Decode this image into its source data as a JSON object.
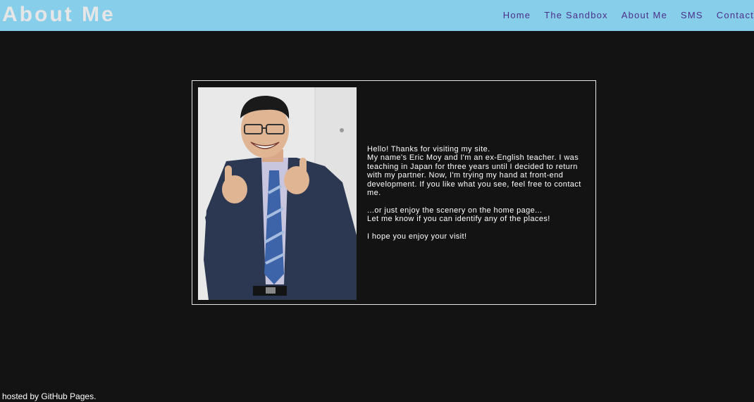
{
  "header": {
    "title": "About Me",
    "background_color": "#87ceeb",
    "nav": [
      {
        "label": "Home"
      },
      {
        "label": "The Sandbox"
      },
      {
        "label": "About Me"
      },
      {
        "label": "SMS"
      },
      {
        "label": "Contact"
      }
    ]
  },
  "profile": {
    "photo_icon": "profile-photo",
    "greeting": "Hello! Thanks for visiting my site.",
    "intro": "My name's Eric Moy and I'm an ex-English teacher. I was teaching in Japan for three years until I decided to return with my partner. Now, I'm trying my hand at front-end development. If you like what you see, feel free to contact me.",
    "scenery": "...or just enjoy the scenery on the home page...",
    "identify": "Let me know if you can identify any of the places!",
    "closing": "I hope you enjoy your visit!"
  },
  "footer": {
    "text": "hosted by GitHub Pages."
  }
}
